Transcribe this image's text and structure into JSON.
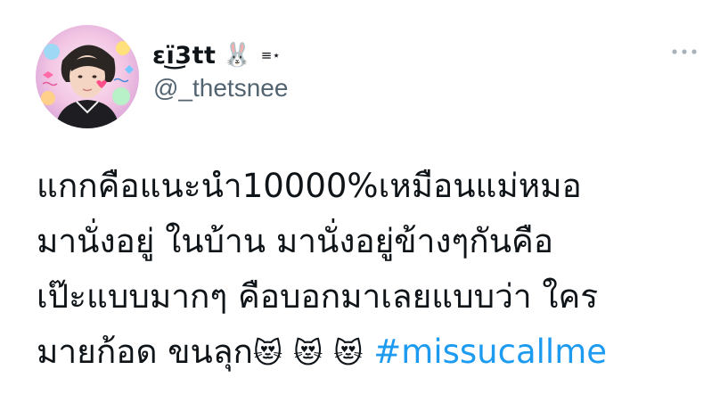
{
  "author": {
    "display_name": "ɛї͜3tt",
    "name_emoji": "🐰",
    "name_decoration": "≡⋆",
    "handle": "@_thetsnee",
    "avatar_icon": "profile-photo"
  },
  "more_icon": "more-dots-icon",
  "tweet": {
    "line1": "แกกคือแนะนำ10000%เหมือนแม่หมอ",
    "line2": "มานั่งอยู่ ในบ้าน มานั่งอยู่ข้างๆกันคือ",
    "line3": "เป๊ะแบบมากๆ คือบอกมาเลยแบบว่า ใคร",
    "line4_text": "มายก้อด ขนลุก",
    "emojis": [
      "😻",
      "😻",
      "😻"
    ],
    "hashtag": "#missucallme"
  },
  "colors": {
    "hashtag": "#1d9bf0",
    "handle": "#536471",
    "text": "#0f1419"
  }
}
